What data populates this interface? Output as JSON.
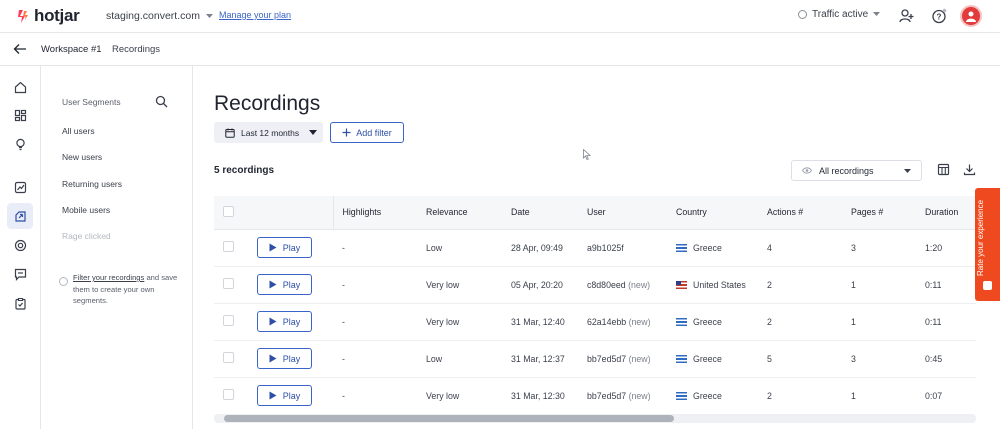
{
  "app": {
    "logo_text": "hotjar",
    "brand_color": "#fd3a5c"
  },
  "topbar": {
    "site": "staging.convert.com",
    "manage_plan": "Manage your plan",
    "traffic_status": "Traffic active"
  },
  "breadcrumb": {
    "workspace": "Workspace #1",
    "current": "Recordings"
  },
  "sidebar_icons": [
    "home-icon",
    "dashboard-icon",
    "lightbulb-icon",
    "trends-icon",
    "recordings-icon",
    "heatmap-icon",
    "feedback-icon",
    "survey-icon"
  ],
  "segments": {
    "title": "User Segments",
    "items": [
      "All users",
      "New users",
      "Returning users",
      "Mobile users"
    ],
    "disabled_item": "Rage clicked",
    "note_link": "Filter your recordings",
    "note_rest": " and save them to create your own segments."
  },
  "main": {
    "title": "Recordings",
    "date_filter": "Last 12 months",
    "add_filter": "Add filter",
    "count": "5 recordings",
    "view_select": "All recordings"
  },
  "table": {
    "columns": [
      "Highlights",
      "Relevance",
      "Date",
      "User",
      "Country",
      "Actions #",
      "Pages #",
      "Duration"
    ],
    "play_label": "Play",
    "rows": [
      {
        "highlights": "-",
        "relevance": "Low",
        "date": "28 Apr, 09:49",
        "user": "a9b1025f",
        "user_tag": "",
        "country": "Greece",
        "flag": "gr",
        "actions": "4",
        "pages": "3",
        "duration": "1:20"
      },
      {
        "highlights": "-",
        "relevance": "Very low",
        "date": "05 Apr, 20:20",
        "user": "c8d80eed",
        "user_tag": "(new)",
        "country": "United States",
        "flag": "us",
        "actions": "2",
        "pages": "1",
        "duration": "0:11"
      },
      {
        "highlights": "-",
        "relevance": "Very low",
        "date": "31 Mar, 12:40",
        "user": "62a14ebb",
        "user_tag": "(new)",
        "country": "Greece",
        "flag": "gr",
        "actions": "2",
        "pages": "1",
        "duration": "0:11"
      },
      {
        "highlights": "-",
        "relevance": "Low",
        "date": "31 Mar, 12:37",
        "user": "bb7ed5d7",
        "user_tag": "(new)",
        "country": "Greece",
        "flag": "gr",
        "actions": "5",
        "pages": "3",
        "duration": "0:45"
      },
      {
        "highlights": "-",
        "relevance": "Very low",
        "date": "31 Mar, 12:30",
        "user": "bb7ed5d7",
        "user_tag": "(new)",
        "country": "Greece",
        "flag": "gr",
        "actions": "2",
        "pages": "1",
        "duration": "0:07"
      }
    ]
  },
  "feedback_tab": {
    "label": "Rate your experience",
    "color": "#ef4a1f"
  }
}
